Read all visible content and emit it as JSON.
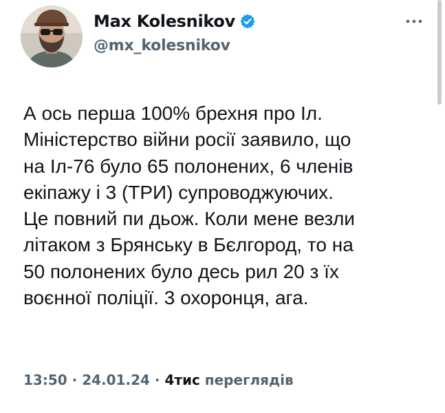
{
  "author": {
    "display_name": "Max Kolesnikov",
    "handle": "@mx_kolesnikov",
    "verified": true,
    "verified_badge_color": "#1d9bf0",
    "avatar_icon": "avatar-photo"
  },
  "more_icon": "more-horizontal-icon",
  "tweet": {
    "text": "А ось перша 100% брехня про Іл.\nМіністерство війни росії заявило, що\nна Іл-76 було 65 полонених, 6 членів\nекіпажу і 3 (ТРИ) супроводжуючих.\nЦе повний пи  дьож. Коли мене везли\nлітаком з Брянську в Бєлгород, то на\n50 полонених було десь рил 20 з їх\nвоєнної поліції. 3 охоронця, ага.",
    "time": "13:50",
    "separator_1": " · ",
    "date": "24.01.24",
    "separator_2": " · ",
    "views_count": "4тис",
    "views_label": " переглядів"
  },
  "colors": {
    "text_primary": "#0f1419",
    "text_secondary": "#536471",
    "background": "#ffffff"
  }
}
